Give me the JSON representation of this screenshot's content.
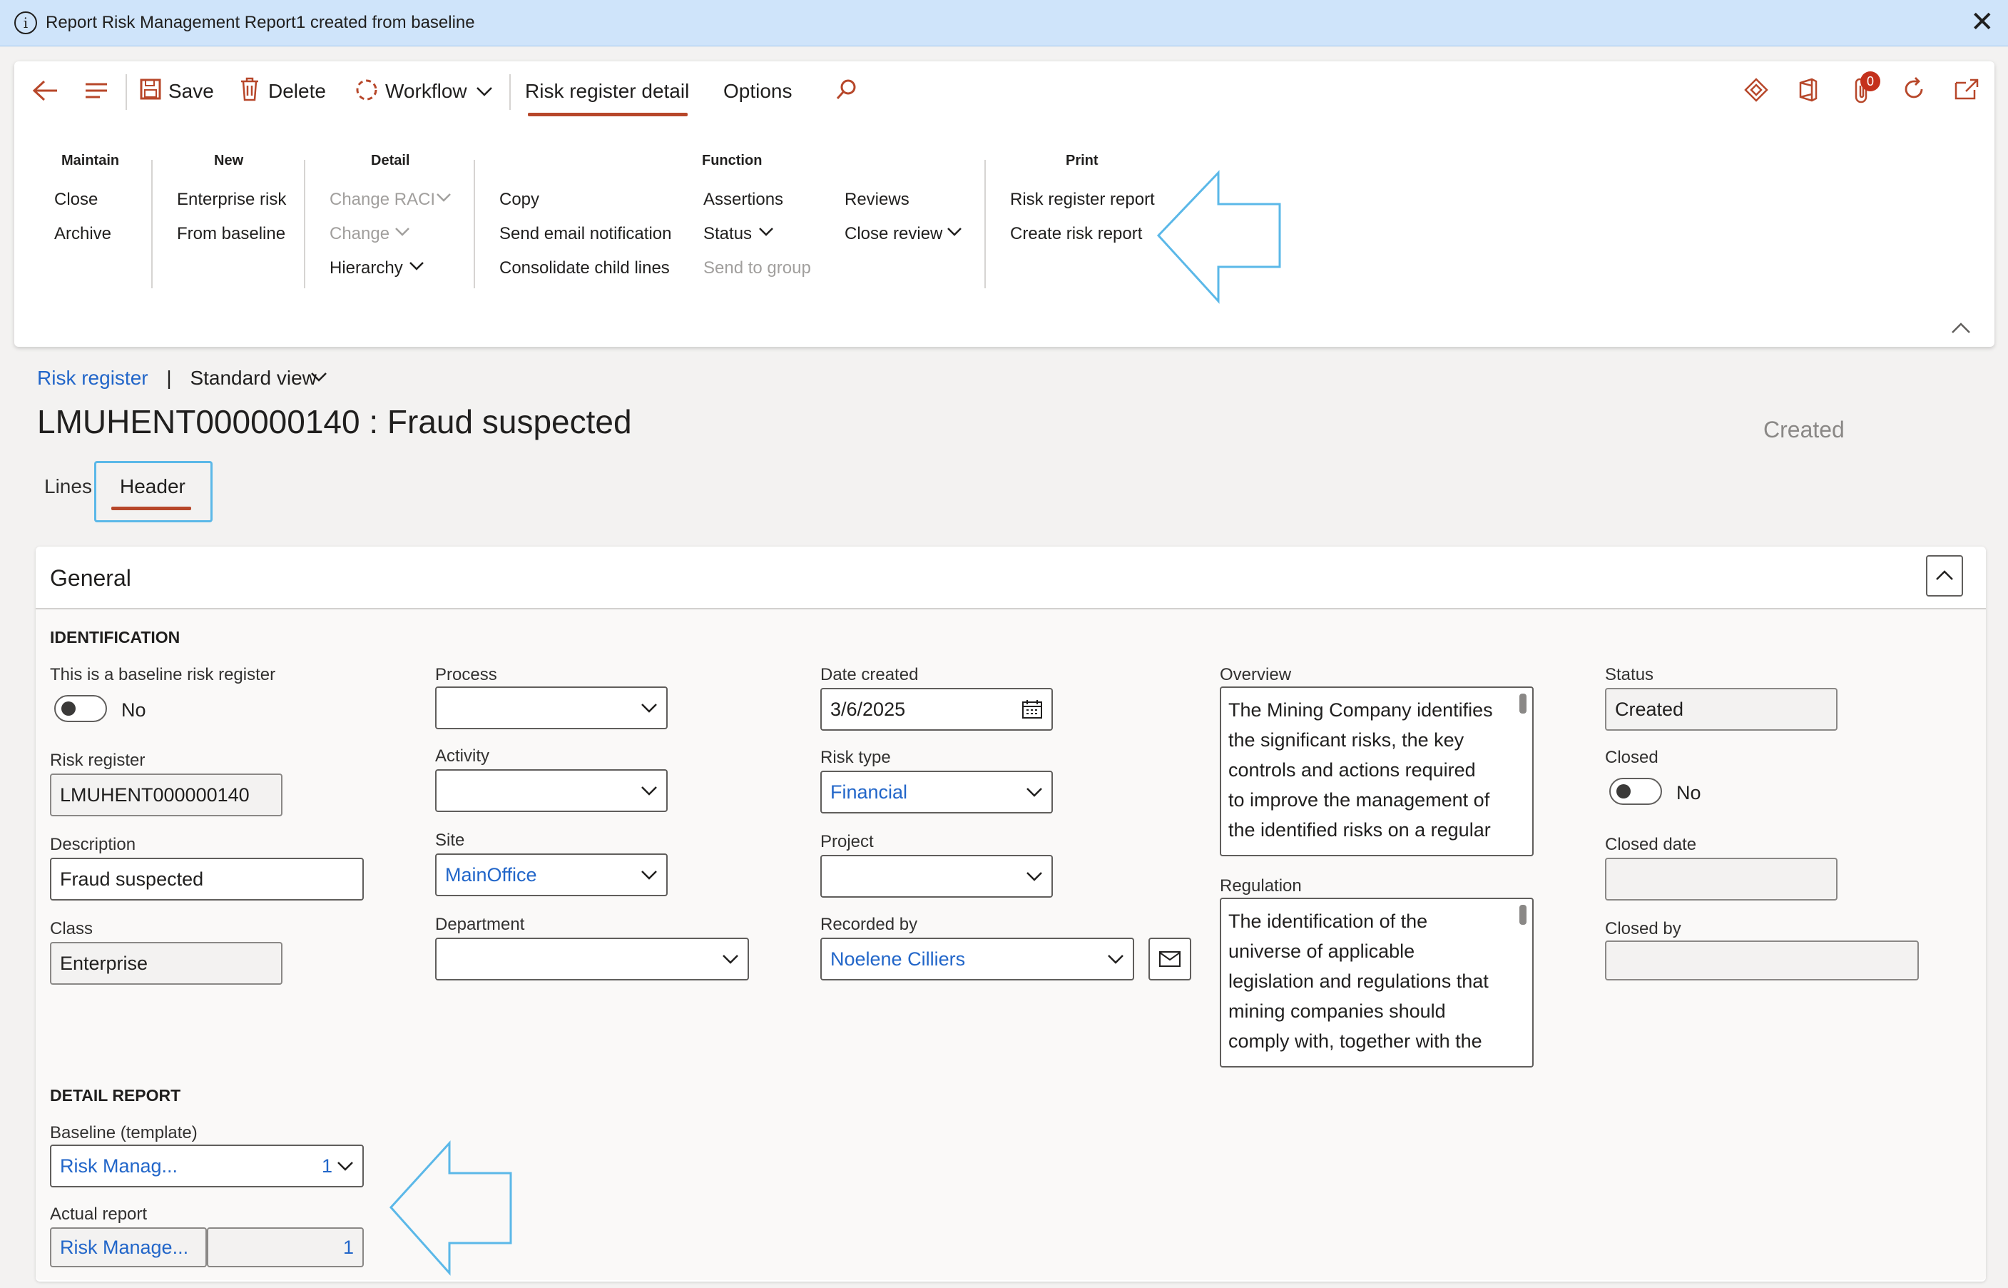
{
  "notification": {
    "message": "Report Risk Management Report1 created from baseline",
    "icon": "info-icon",
    "close_icon": "close-icon"
  },
  "toolbar": {
    "save": "Save",
    "delete": "Delete",
    "workflow": "Workflow",
    "tab_active": "Risk register detail",
    "tab_options": "Options",
    "badge_count": "0"
  },
  "ribbon": {
    "maintain": {
      "title": "Maintain",
      "items": [
        "Close",
        "Archive"
      ]
    },
    "new": {
      "title": "New",
      "items": [
        "Enterprise risk",
        "From baseline"
      ]
    },
    "detail": {
      "title": "Detail",
      "items": [
        "Change RACI",
        "Change",
        "Hierarchy"
      ]
    },
    "function": {
      "title": "Function",
      "col1": [
        "Copy",
        "Send email notification",
        "Consolidate child lines"
      ],
      "col2": [
        "Assertions",
        "Status",
        "Send to group"
      ],
      "col3": [
        "Reviews",
        "Close review"
      ]
    },
    "print": {
      "title": "Print",
      "items": [
        "Risk register report",
        "Create risk report"
      ]
    }
  },
  "breadcrumb": {
    "link": "Risk register",
    "separator": "|",
    "view": "Standard view"
  },
  "page": {
    "title": "LMUHENT000000140 : Fraud suspected",
    "status": "Created"
  },
  "tabs": [
    "Lines",
    "Header"
  ],
  "section": {
    "title": "General"
  },
  "identification": {
    "heading": "IDENTIFICATION",
    "baseline_label": "This is a baseline risk register",
    "baseline_value": "No",
    "risk_register_label": "Risk register",
    "risk_register_value": "LMUHENT000000140",
    "description_label": "Description",
    "description_value": "Fraud suspected",
    "class_label": "Class",
    "class_value": "Enterprise",
    "process_label": "Process",
    "process_value": "",
    "activity_label": "Activity",
    "activity_value": "",
    "site_label": "Site",
    "site_value": "MainOffice",
    "department_label": "Department",
    "department_value": "",
    "date_created_label": "Date created",
    "date_created_value": "3/6/2025",
    "risk_type_label": "Risk type",
    "risk_type_value": "Financial",
    "project_label": "Project",
    "project_value": "",
    "recorded_by_label": "Recorded by",
    "recorded_by_value": "Noelene Cilliers",
    "overview_label": "Overview",
    "overview_lines": [
      "The Mining Company identifies",
      "the significant risks, the key",
      "controls and actions required",
      "to improve the management of",
      "the identified risks on a regular"
    ],
    "regulation_label": "Regulation",
    "regulation_lines": [
      "The identification of the",
      "universe of applicable",
      "legislation and regulations that",
      "mining companies should",
      "comply with, together with the"
    ],
    "status_label": "Status",
    "status_value": "Created",
    "closed_label": "Closed",
    "closed_value": "No",
    "closed_date_label": "Closed date",
    "closed_date_value": "",
    "closed_by_label": "Closed by",
    "closed_by_value": ""
  },
  "detail_report": {
    "heading": "DETAIL REPORT",
    "baseline_label": "Baseline (template)",
    "baseline_value": "Risk Manag...",
    "baseline_version": "1",
    "actual_label": "Actual report",
    "actual_value": "Risk Manage...",
    "actual_version": "1"
  },
  "colors": {
    "accent": "#b7472a",
    "link": "#2266c9",
    "highlight": "#5bb8e8"
  }
}
